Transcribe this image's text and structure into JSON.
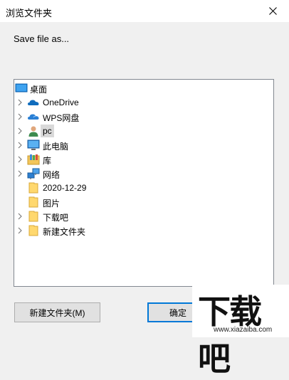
{
  "window": {
    "title": "浏览文件夹",
    "close_icon": "close-icon"
  },
  "prompt": "Save file as...",
  "tree": {
    "items": [
      {
        "label": "桌面",
        "icon": "desktop-icon",
        "expandable": false,
        "depth": 0
      },
      {
        "label": "OneDrive",
        "icon": "cloud-icon",
        "expandable": true,
        "depth": 1
      },
      {
        "label": "WPS网盘",
        "icon": "cloud-icon",
        "expandable": true,
        "depth": 1
      },
      {
        "label": "pc",
        "icon": "user-icon",
        "expandable": true,
        "depth": 1,
        "selected": true
      },
      {
        "label": "此电脑",
        "icon": "computer-icon",
        "expandable": true,
        "depth": 1
      },
      {
        "label": "库",
        "icon": "library-icon",
        "expandable": true,
        "depth": 1
      },
      {
        "label": "网络",
        "icon": "network-icon",
        "expandable": true,
        "depth": 1
      },
      {
        "label": "2020-12-29",
        "icon": "folder-icon",
        "expandable": false,
        "depth": 1
      },
      {
        "label": "图片",
        "icon": "folder-icon",
        "expandable": false,
        "depth": 1
      },
      {
        "label": "下载吧",
        "icon": "folder-icon",
        "expandable": true,
        "depth": 1
      },
      {
        "label": "新建文件夹",
        "icon": "folder-icon",
        "expandable": true,
        "depth": 1
      }
    ]
  },
  "buttons": {
    "new_folder": "新建文件夹(M)",
    "ok": "确定"
  },
  "watermark": {
    "text": "下载吧",
    "url": "www.xiazaiba.com"
  },
  "colors": {
    "accent": "#0078d7",
    "folder": "#ffd86e",
    "selection": "#d9d9d9"
  }
}
